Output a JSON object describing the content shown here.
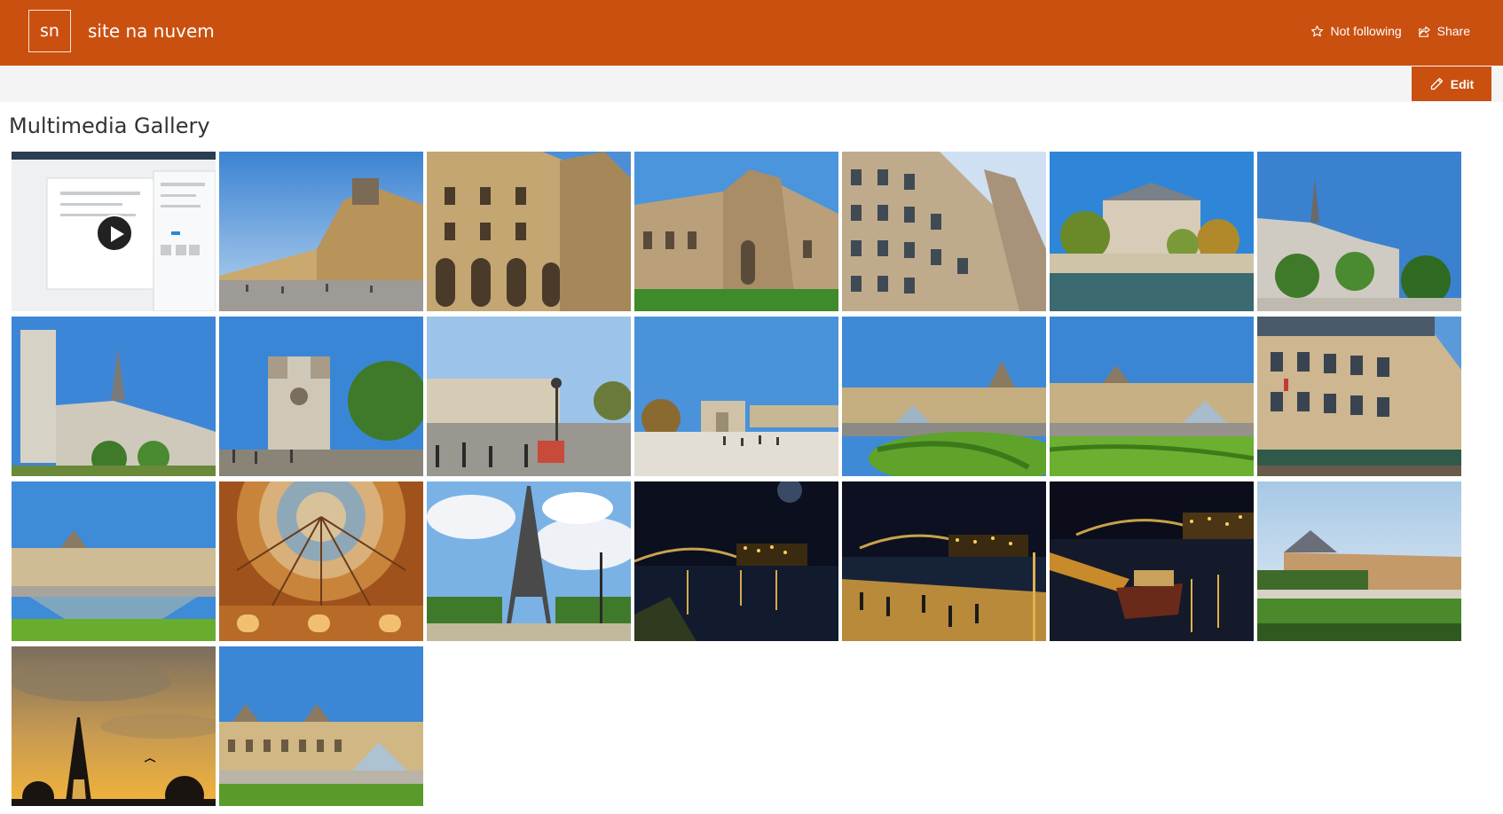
{
  "site": {
    "logo_text": "sn",
    "title": "site na nuvem"
  },
  "header_actions": {
    "follow_label": "Not following",
    "share_label": "Share"
  },
  "command_bar": {
    "edit_label": "Edit"
  },
  "gallery": {
    "title": "Multimedia Gallery",
    "items": [
      {
        "kind": "video",
        "subject": "app-screenshot"
      },
      {
        "kind": "photo",
        "subject": "louvre-courtyard"
      },
      {
        "kind": "photo",
        "subject": "louvre-facade"
      },
      {
        "kind": "photo",
        "subject": "palace-lawn"
      },
      {
        "kind": "photo",
        "subject": "haussmann-building"
      },
      {
        "kind": "photo",
        "subject": "seine-riverbank"
      },
      {
        "kind": "photo",
        "subject": "notre-dame-side"
      },
      {
        "kind": "photo",
        "subject": "notre-dame-spire"
      },
      {
        "kind": "photo",
        "subject": "notre-dame-front"
      },
      {
        "kind": "photo",
        "subject": "paris-street"
      },
      {
        "kind": "photo",
        "subject": "carrousel-arch"
      },
      {
        "kind": "photo",
        "subject": "louvre-pyramid-garden"
      },
      {
        "kind": "photo",
        "subject": "louvre-pyramid-lawn"
      },
      {
        "kind": "photo",
        "subject": "hotel-facade"
      },
      {
        "kind": "photo",
        "subject": "louvre-fountain"
      },
      {
        "kind": "photo",
        "subject": "galeries-lafayette-dome"
      },
      {
        "kind": "photo",
        "subject": "eiffel-tower-day"
      },
      {
        "kind": "photo",
        "subject": "porto-bridge-night"
      },
      {
        "kind": "photo",
        "subject": "porto-promenade-night"
      },
      {
        "kind": "photo",
        "subject": "porto-boats-night"
      },
      {
        "kind": "photo",
        "subject": "louvre-hedge-garden"
      },
      {
        "kind": "photo",
        "subject": "eiffel-tower-sunset"
      },
      {
        "kind": "photo",
        "subject": "louvre-pyramid-wide"
      }
    ]
  },
  "colors": {
    "theme": "#ca5010",
    "command_bar": "#f4f4f4"
  }
}
